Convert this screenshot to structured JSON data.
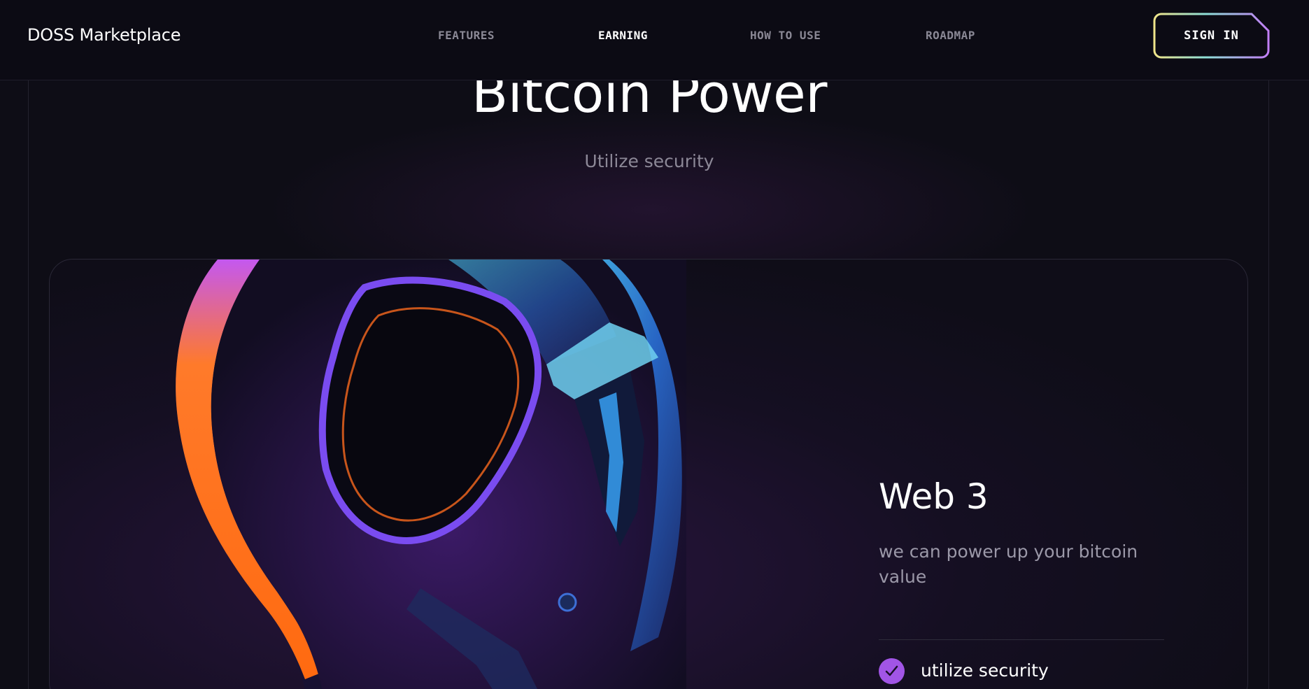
{
  "header": {
    "logo": "DOSS Marketplace",
    "nav": [
      {
        "label": "FEATURES",
        "active": false
      },
      {
        "label": "EARNING",
        "active": true
      },
      {
        "label": "HOW TO USE",
        "active": false
      },
      {
        "label": "ROADMAP",
        "active": false
      }
    ],
    "sign_in_label": "SIGN IN"
  },
  "hero": {
    "title": "Bitcoin Power",
    "subtitle": "Utilize security"
  },
  "card": {
    "title": "Web 3",
    "text": "we can power up your bitcoin value",
    "features": [
      {
        "label": "utilize security",
        "icon": "check-icon"
      }
    ],
    "image_icon": "helmet-illustration"
  },
  "colors": {
    "background": "#0e0d16",
    "accent": "#a155e6",
    "gradient_start": "#f0e58a",
    "gradient_mid": "#8ee0d8",
    "gradient_end": "#c17ef5"
  }
}
